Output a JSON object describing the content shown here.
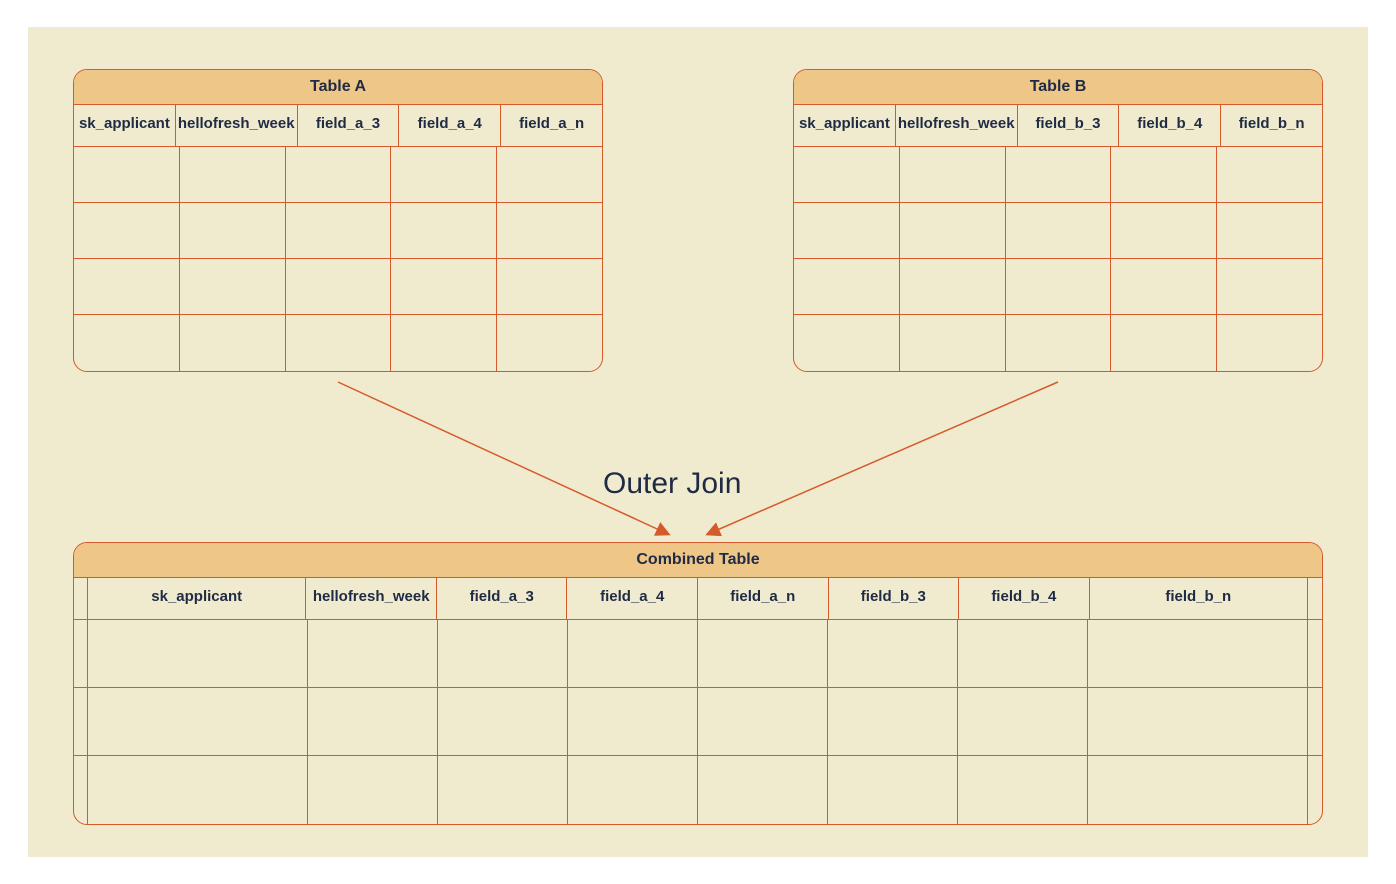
{
  "colors": {
    "background": "#f0ebcf",
    "tableBorder": "#d55a2b",
    "titleBg": "#eec788",
    "text": "#1f2a44"
  },
  "joinLabel": "Outer Join",
  "tableA": {
    "title": "Table A",
    "columns": [
      "sk_applicant",
      "hellofresh_week",
      "field_a_3",
      "field_a_4",
      "field_a_n"
    ],
    "emptyRowCount": 4
  },
  "tableB": {
    "title": "Table B",
    "columns": [
      "sk_applicant",
      "hellofresh_week",
      "field_b_3",
      "field_b_4",
      "field_b_n"
    ],
    "emptyRowCount": 4
  },
  "tableCombined": {
    "title": "Combined Table",
    "columns": [
      "sk_applicant",
      "hellofresh_week",
      "field_a_3",
      "field_a_4",
      "field_a_n",
      "field_b_3",
      "field_b_4",
      "field_b_n"
    ],
    "emptyRowCount": 3,
    "leadingNarrowCell": true,
    "trailingNarrowCell": true
  }
}
